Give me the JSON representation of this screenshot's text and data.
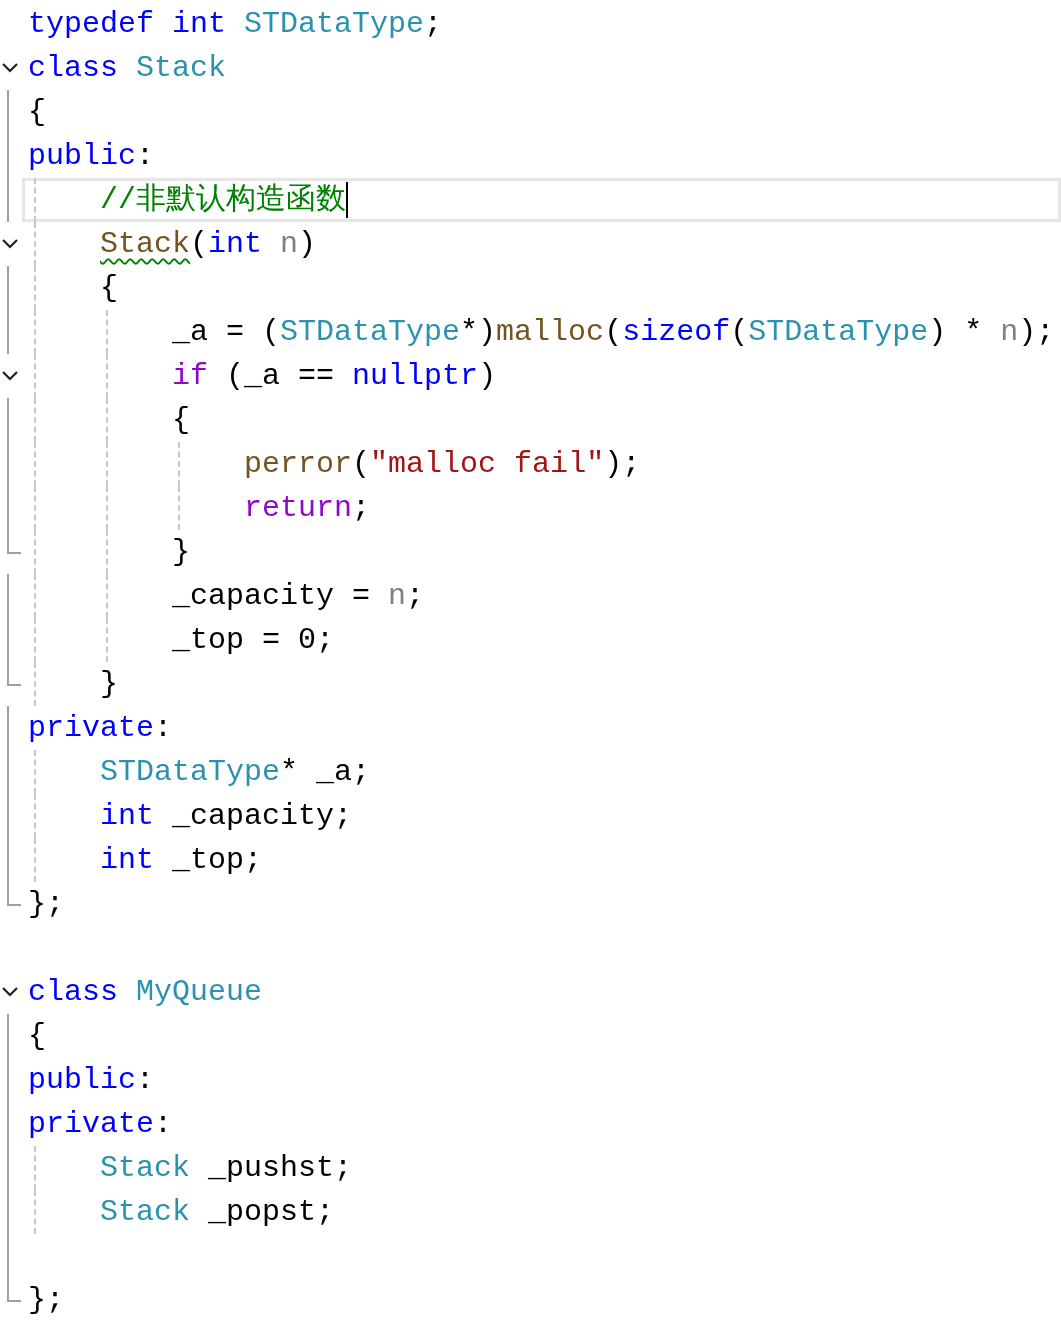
{
  "lines": [
    {
      "kind": "plain",
      "current": false,
      "tokens": [
        {
          "text": "typedef ",
          "kind": "keyword"
        },
        {
          "text": "int ",
          "kind": "keyword"
        },
        {
          "text": "STDataType",
          "kind": "type"
        },
        {
          "text": ";",
          "kind": "plain"
        }
      ]
    },
    {
      "kind": "fold-start",
      "current": false,
      "tokens": [
        {
          "text": "class ",
          "kind": "keyword"
        },
        {
          "text": "Stack",
          "kind": "type"
        }
      ]
    },
    {
      "kind": "fold-body",
      "current": false,
      "tokens": [
        {
          "text": "{",
          "kind": "plain"
        }
      ]
    },
    {
      "kind": "fold-body",
      "current": false,
      "tokens": [
        {
          "text": "public",
          "kind": "keyword"
        },
        {
          "text": ":",
          "kind": "plain"
        }
      ]
    },
    {
      "kind": "fold-body",
      "current": true,
      "tokens": [
        {
          "text": "    //非默认构造函数",
          "kind": "comment"
        }
      ]
    },
    {
      "kind": "fold-start",
      "current": false,
      "tokens": [
        {
          "text": "    Stack",
          "kind": "func",
          "squiggle": true
        },
        {
          "text": "(",
          "kind": "plain"
        },
        {
          "text": "int ",
          "kind": "keyword"
        },
        {
          "text": "n",
          "kind": "param"
        },
        {
          "text": ")",
          "kind": "plain"
        }
      ]
    },
    {
      "kind": "fold-body",
      "current": false,
      "tokens": [
        {
          "text": "    {",
          "kind": "plain"
        }
      ]
    },
    {
      "kind": "fold-body",
      "current": false,
      "tokens": [
        {
          "text": "        _a = (",
          "kind": "plain"
        },
        {
          "text": "STDataType",
          "kind": "type"
        },
        {
          "text": "*)",
          "kind": "plain"
        },
        {
          "text": "malloc",
          "kind": "func"
        },
        {
          "text": "(",
          "kind": "plain"
        },
        {
          "text": "sizeof",
          "kind": "keyword"
        },
        {
          "text": "(",
          "kind": "plain"
        },
        {
          "text": "STDataType",
          "kind": "type"
        },
        {
          "text": ") * ",
          "kind": "plain"
        },
        {
          "text": "n",
          "kind": "param"
        },
        {
          "text": ");",
          "kind": "plain"
        }
      ]
    },
    {
      "kind": "fold-start",
      "current": false,
      "tokens": [
        {
          "text": "        if",
          "kind": "control"
        },
        {
          "text": " (_a == ",
          "kind": "plain"
        },
        {
          "text": "nullptr",
          "kind": "keyword"
        },
        {
          "text": ")",
          "kind": "plain"
        }
      ]
    },
    {
      "kind": "fold-body",
      "current": false,
      "tokens": [
        {
          "text": "        {",
          "kind": "plain"
        }
      ]
    },
    {
      "kind": "fold-body",
      "current": false,
      "tokens": [
        {
          "text": "            perror",
          "kind": "func"
        },
        {
          "text": "(",
          "kind": "plain"
        },
        {
          "text": "\"malloc fail\"",
          "kind": "string"
        },
        {
          "text": ");",
          "kind": "plain"
        }
      ]
    },
    {
      "kind": "fold-body",
      "current": false,
      "tokens": [
        {
          "text": "            return",
          "kind": "control"
        },
        {
          "text": ";",
          "kind": "plain"
        }
      ]
    },
    {
      "kind": "fold-end",
      "current": false,
      "tokens": [
        {
          "text": "        }",
          "kind": "plain"
        }
      ]
    },
    {
      "kind": "fold-body",
      "current": false,
      "tokens": [
        {
          "text": "        _capacity = ",
          "kind": "plain"
        },
        {
          "text": "n",
          "kind": "param"
        },
        {
          "text": ";",
          "kind": "plain"
        }
      ]
    },
    {
      "kind": "fold-body",
      "current": false,
      "tokens": [
        {
          "text": "        _top = 0;",
          "kind": "plain"
        }
      ]
    },
    {
      "kind": "fold-end",
      "current": false,
      "tokens": [
        {
          "text": "    }",
          "kind": "plain"
        }
      ]
    },
    {
      "kind": "fold-body",
      "current": false,
      "tokens": [
        {
          "text": "private",
          "kind": "keyword"
        },
        {
          "text": ":",
          "kind": "plain"
        }
      ]
    },
    {
      "kind": "fold-body",
      "current": false,
      "tokens": [
        {
          "text": "    STDataType",
          "kind": "type"
        },
        {
          "text": "* _a;",
          "kind": "plain"
        }
      ]
    },
    {
      "kind": "fold-body",
      "current": false,
      "tokens": [
        {
          "text": "    int",
          "kind": "keyword"
        },
        {
          "text": " _capacity;",
          "kind": "plain"
        }
      ]
    },
    {
      "kind": "fold-body",
      "current": false,
      "tokens": [
        {
          "text": "    int",
          "kind": "keyword"
        },
        {
          "text": " _top;",
          "kind": "plain"
        }
      ]
    },
    {
      "kind": "fold-end",
      "current": false,
      "tokens": [
        {
          "text": "};",
          "kind": "plain"
        }
      ]
    },
    {
      "kind": "plain",
      "current": false
    },
    {
      "kind": "fold-start",
      "current": false,
      "tokens": [
        {
          "text": "class ",
          "kind": "keyword"
        },
        {
          "text": "MyQueue",
          "kind": "type"
        }
      ]
    },
    {
      "kind": "fold-body",
      "current": false,
      "tokens": [
        {
          "text": "{",
          "kind": "plain"
        }
      ]
    },
    {
      "kind": "fold-body",
      "current": false,
      "tokens": [
        {
          "text": "public",
          "kind": "keyword"
        },
        {
          "text": ":",
          "kind": "plain"
        }
      ]
    },
    {
      "kind": "fold-body",
      "current": false,
      "tokens": [
        {
          "text": "private",
          "kind": "keyword"
        },
        {
          "text": ":",
          "kind": "plain"
        }
      ]
    },
    {
      "kind": "fold-body",
      "current": false,
      "tokens": [
        {
          "text": "    Stack",
          "kind": "type"
        },
        {
          "text": " _pushst;",
          "kind": "plain"
        }
      ]
    },
    {
      "kind": "fold-body",
      "current": false,
      "tokens": [
        {
          "text": "    Stack",
          "kind": "type"
        },
        {
          "text": " _popst;",
          "kind": "plain"
        }
      ]
    },
    {
      "kind": "fold-body",
      "current": false
    },
    {
      "kind": "fold-end",
      "current": false,
      "tokens": [
        {
          "text": "};",
          "kind": "plain"
        }
      ]
    }
  ]
}
